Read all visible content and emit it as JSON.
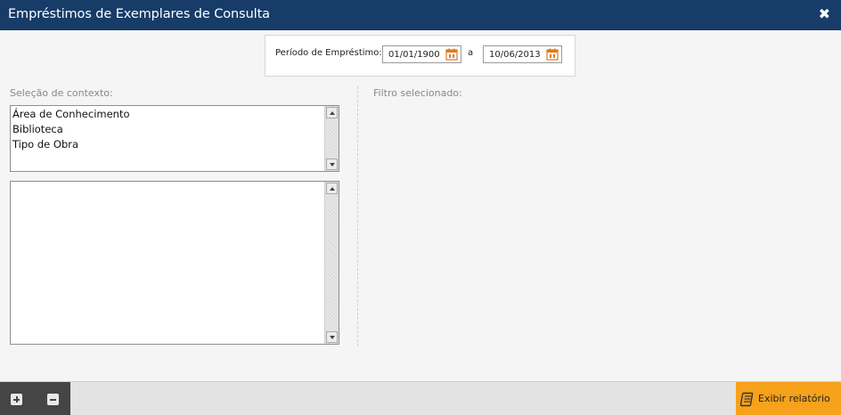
{
  "window": {
    "title": "Empréstimos de Exemplares de Consulta",
    "close_glyph": "✖"
  },
  "period": {
    "label": "Período de Empréstimo:",
    "start_date": "01/01/1900",
    "separator": "a",
    "end_date": "10/06/2013"
  },
  "context": {
    "label": "Seleção de contexto:",
    "options": [
      "Área de Conhecimento",
      "Biblioteca",
      "Tipo de Obra"
    ],
    "values": []
  },
  "filter": {
    "label": "Filtro selecionado:"
  },
  "footer": {
    "report_label": "Exibir relatório"
  },
  "colors": {
    "titlebar": "#173c68",
    "report_button": "#f6a21a",
    "tools_bg": "#454545",
    "calendar_icon": "#e07a1a"
  }
}
